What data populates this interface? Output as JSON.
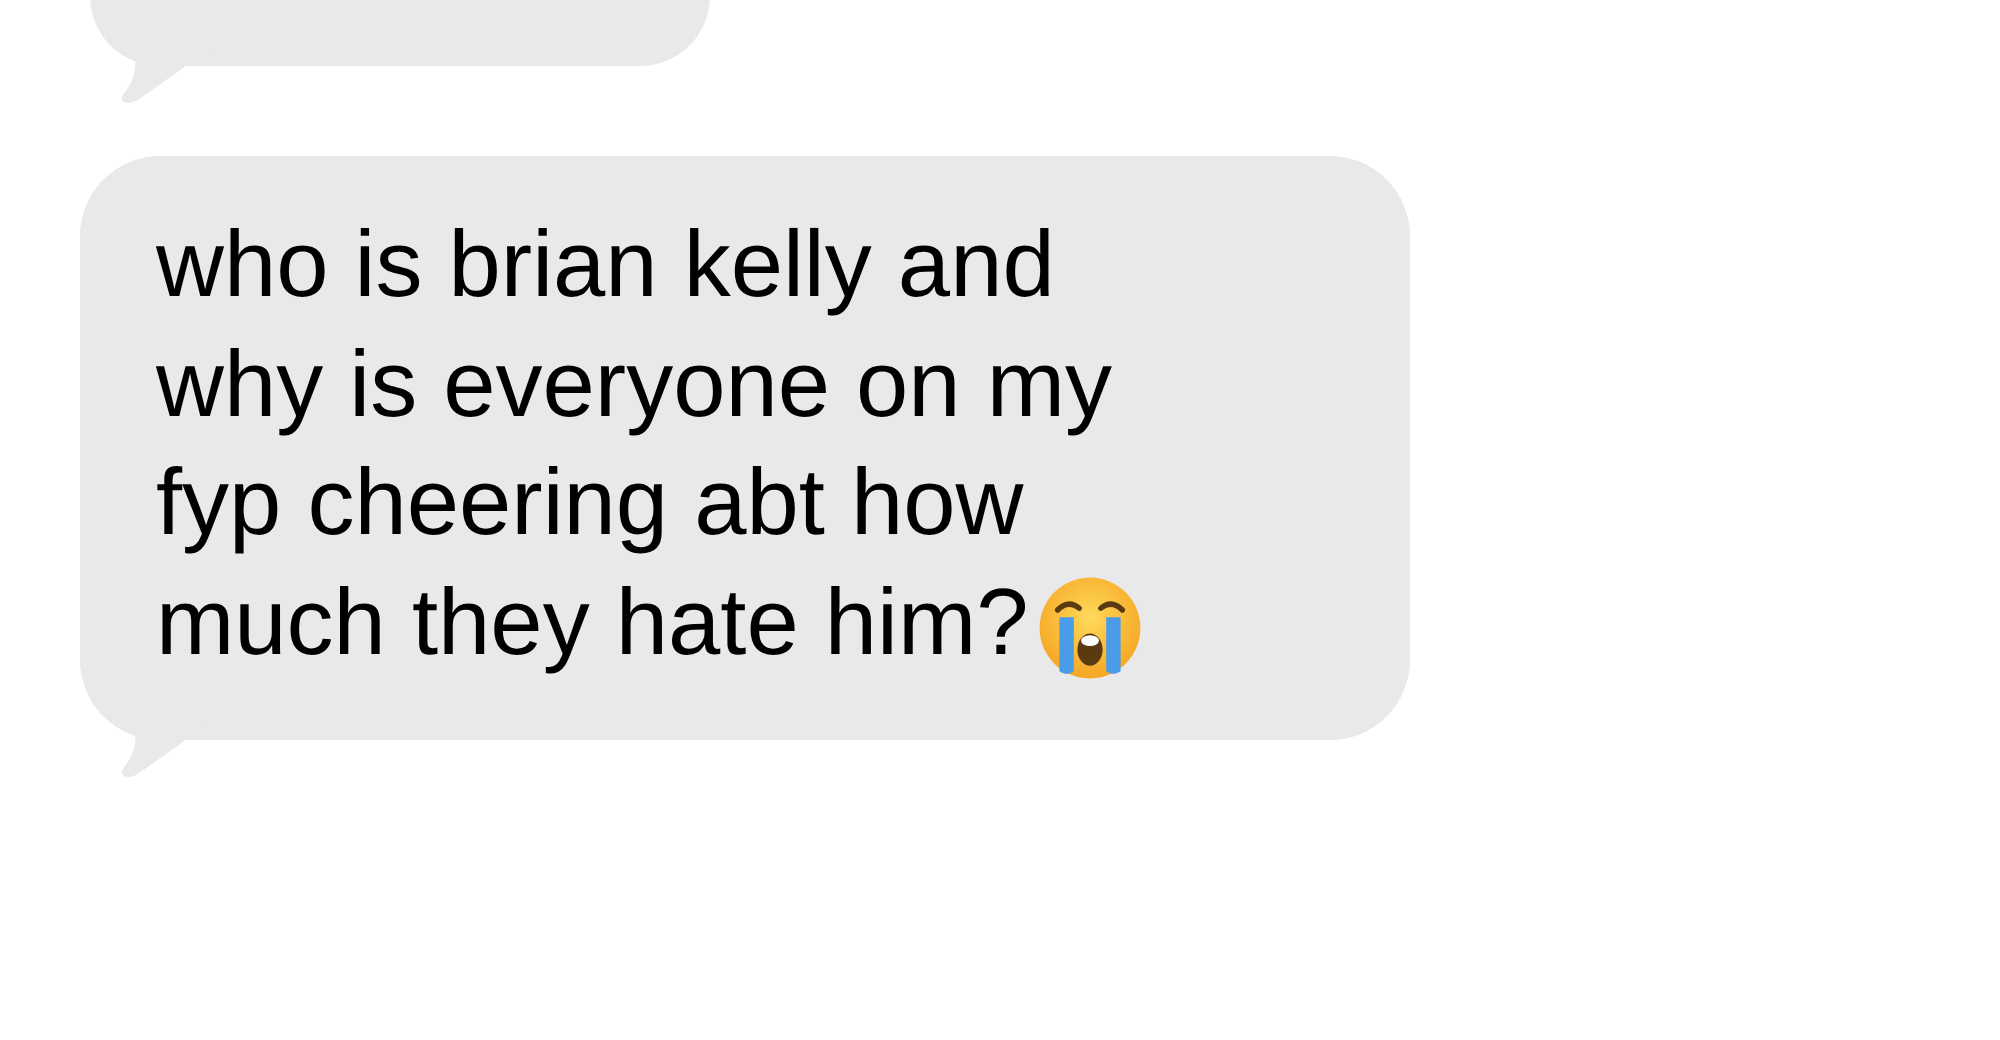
{
  "messages": [
    {
      "kind": "cut_off"
    },
    {
      "kind": "text",
      "lines": [
        "who is brian kelly and",
        "why is everyone on my",
        "fyp cheering abt how",
        "much they hate him?"
      ],
      "ends_with_emoji": true
    }
  ]
}
